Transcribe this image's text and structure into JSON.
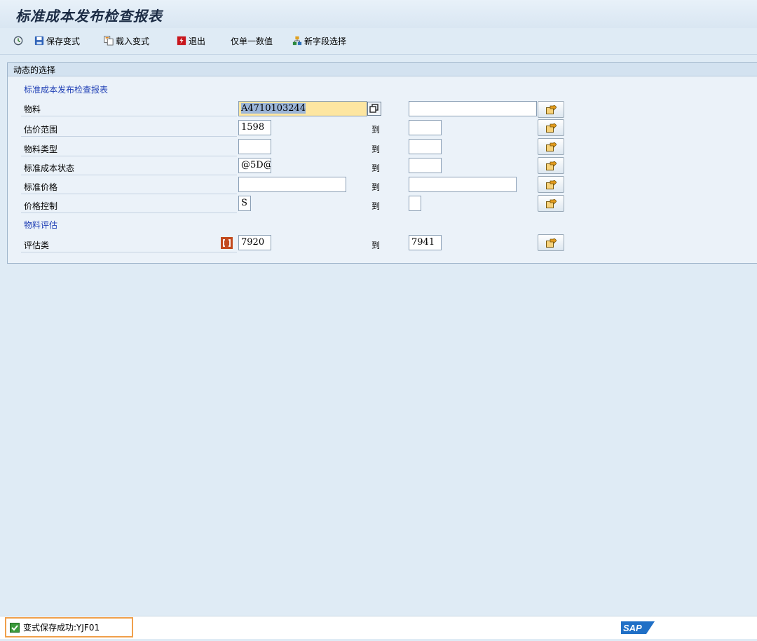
{
  "window": {
    "title": "标准成本发布检查报表"
  },
  "toolbar": {
    "save_variant": "保存变式",
    "load_variant": "载入变式",
    "exit": "退出",
    "single_value": "仅单一数值",
    "new_field": "新字段选择"
  },
  "panel": {
    "title": "动态的选择"
  },
  "sections": {
    "report": "标准成本发布检查报表",
    "valuation": "物料评估"
  },
  "to_label": "到",
  "fields": {
    "material": {
      "label": "物料",
      "from": "A4710103244",
      "to": ""
    },
    "valuation_area": {
      "label": "估价范围",
      "from": "1598",
      "to": ""
    },
    "material_type": {
      "label": "物料类型",
      "from": "",
      "to": ""
    },
    "cost_status": {
      "label": "标准成本状态",
      "from": "@5D@",
      "to": ""
    },
    "standard_price": {
      "label": "标准价格",
      "from": "",
      "to": ""
    },
    "price_control": {
      "label": "价格控制",
      "from": "S",
      "to": ""
    },
    "valuation_class": {
      "label": "评估类",
      "from": "7920",
      "to": "7941"
    }
  },
  "status": {
    "message": "变式保存成功:YJF01"
  },
  "brand": {
    "logo_text": "SAP"
  },
  "colors": {
    "section_blue": "#1f3fb5",
    "highlight": "#fde6a1",
    "status_border": "#f0a04b",
    "sap_blue": "#1f6fc6"
  }
}
